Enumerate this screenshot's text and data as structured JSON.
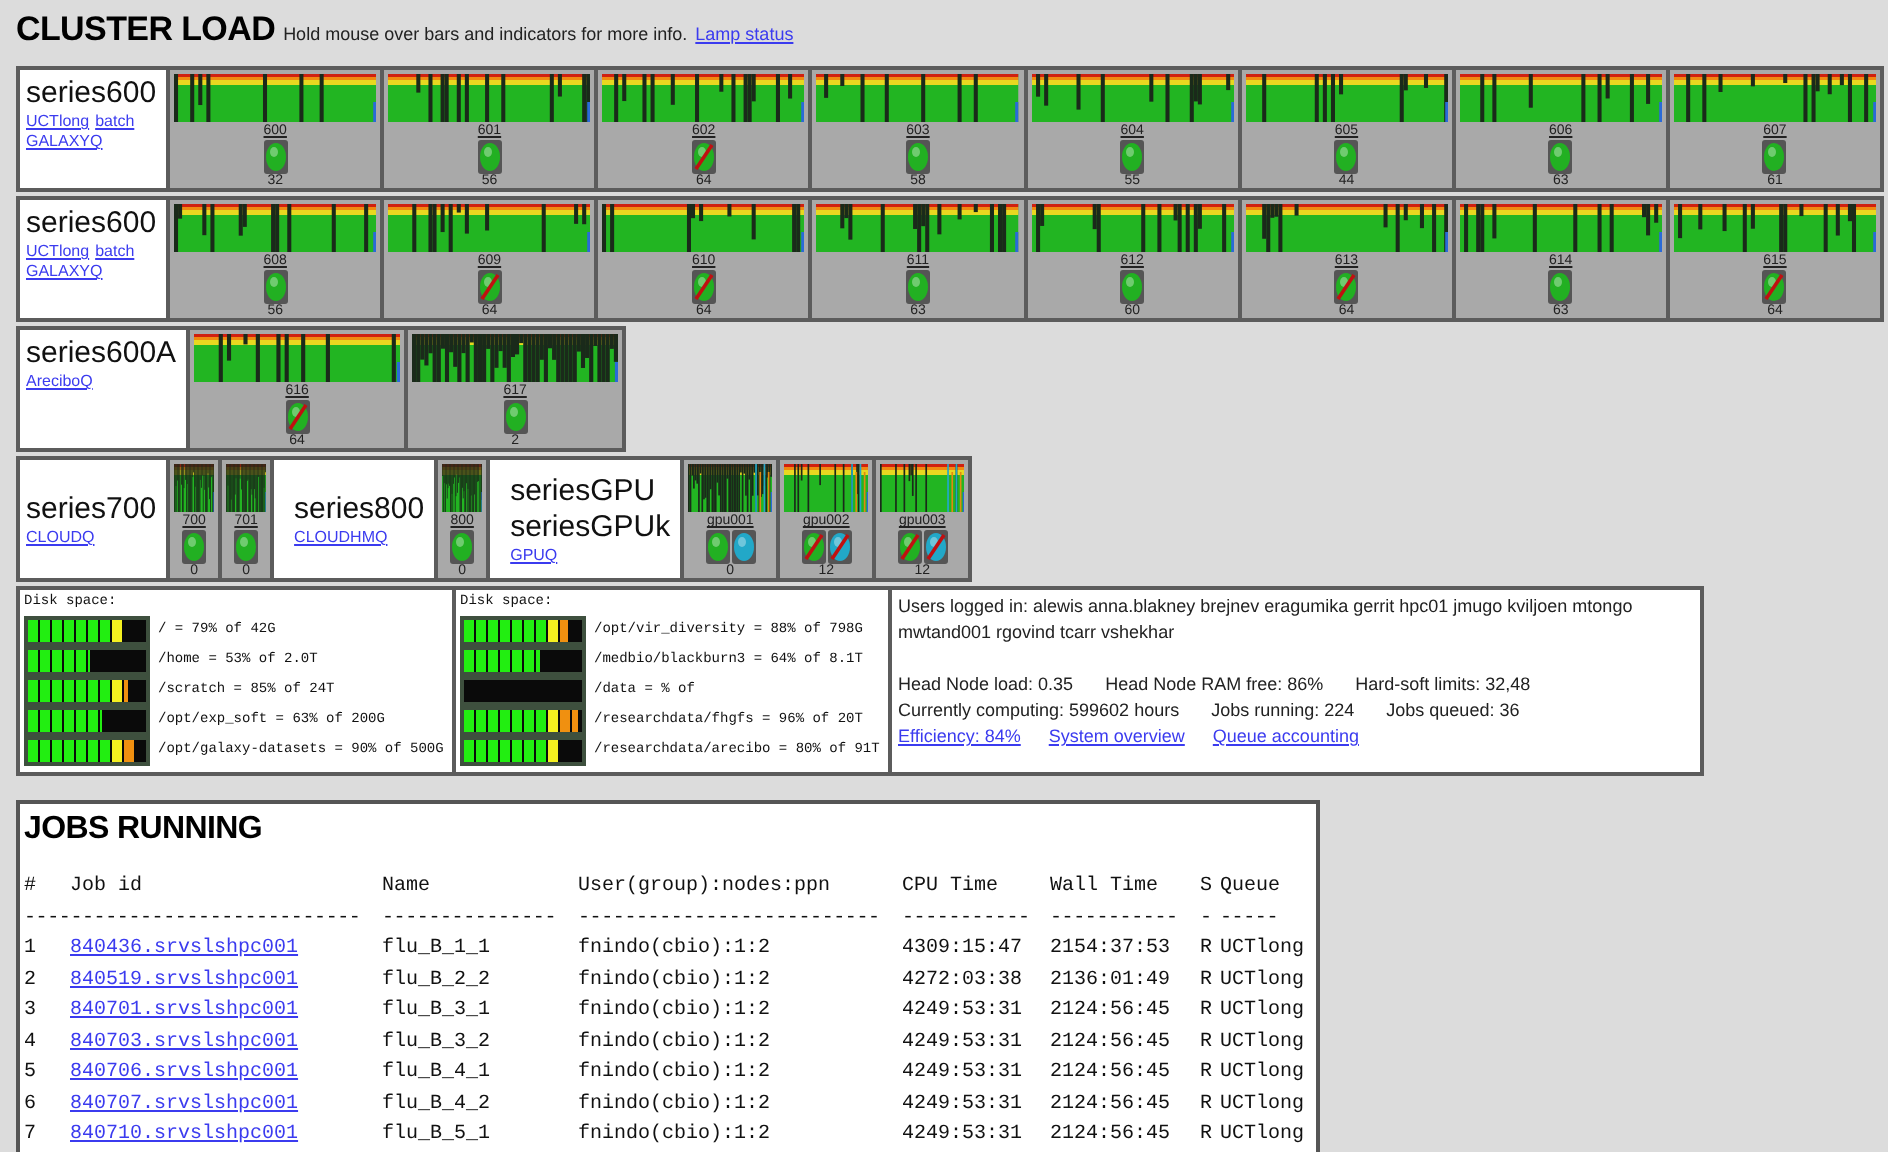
{
  "header": {
    "title": "CLUSTER LOAD",
    "hint": "Hold mouse over bars and indicators for more info.",
    "link": "Lamp status"
  },
  "rows": [
    {
      "kind": "full",
      "groups": [
        {
          "names": [
            "series600"
          ],
          "links": [
            "UCTlong",
            "batch",
            "GALAXYQ"
          ],
          "nodes": [
            {
              "name": "600",
              "count": "32",
              "idle": false,
              "lamps": [
                {
                  "color": "#22b022",
                  "crossed": false
                }
              ]
            },
            {
              "name": "601",
              "count": "56",
              "idle": false,
              "lamps": [
                {
                  "color": "#22b022",
                  "crossed": false
                }
              ]
            },
            {
              "name": "602",
              "count": "64",
              "idle": false,
              "lamps": [
                {
                  "color": "#22b022",
                  "crossed": true
                }
              ]
            },
            {
              "name": "603",
              "count": "58",
              "idle": false,
              "lamps": [
                {
                  "color": "#22b022",
                  "crossed": false
                }
              ]
            },
            {
              "name": "604",
              "count": "55",
              "idle": false,
              "lamps": [
                {
                  "color": "#22b022",
                  "crossed": false
                }
              ]
            },
            {
              "name": "605",
              "count": "44",
              "idle": false,
              "lamps": [
                {
                  "color": "#22b022",
                  "crossed": false
                }
              ]
            },
            {
              "name": "606",
              "count": "63",
              "idle": false,
              "lamps": [
                {
                  "color": "#22b022",
                  "crossed": false
                }
              ]
            },
            {
              "name": "607",
              "count": "61",
              "idle": false,
              "lamps": [
                {
                  "color": "#22b022",
                  "crossed": false
                }
              ]
            }
          ]
        }
      ]
    },
    {
      "kind": "full",
      "groups": [
        {
          "names": [
            "series600"
          ],
          "links": [
            "UCTlong",
            "batch",
            "GALAXYQ"
          ],
          "nodes": [
            {
              "name": "608",
              "count": "56",
              "idle": false,
              "lamps": [
                {
                  "color": "#22b022",
                  "crossed": false
                }
              ]
            },
            {
              "name": "609",
              "count": "64",
              "idle": false,
              "lamps": [
                {
                  "color": "#22b022",
                  "crossed": true
                }
              ]
            },
            {
              "name": "610",
              "count": "64",
              "idle": false,
              "lamps": [
                {
                  "color": "#22b022",
                  "crossed": true
                }
              ]
            },
            {
              "name": "611",
              "count": "63",
              "idle": false,
              "lamps": [
                {
                  "color": "#22b022",
                  "crossed": false
                }
              ]
            },
            {
              "name": "612",
              "count": "60",
              "idle": false,
              "lamps": [
                {
                  "color": "#22b022",
                  "crossed": false
                }
              ]
            },
            {
              "name": "613",
              "count": "64",
              "idle": false,
              "lamps": [
                {
                  "color": "#22b022",
                  "crossed": true
                }
              ]
            },
            {
              "name": "614",
              "count": "63",
              "idle": false,
              "lamps": [
                {
                  "color": "#22b022",
                  "crossed": false
                }
              ]
            },
            {
              "name": "615",
              "count": "64",
              "idle": false,
              "lamps": [
                {
                  "color": "#22b022",
                  "crossed": true
                }
              ]
            }
          ]
        }
      ]
    },
    {
      "kind": "fixed",
      "groups": [
        {
          "names": [
            "series600A"
          ],
          "links": [
            "AreciboQ"
          ],
          "nodes": [
            {
              "name": "616",
              "count": "64",
              "idle": false,
              "lamps": [
                {
                  "color": "#22b022",
                  "crossed": true
                }
              ]
            },
            {
              "name": "617",
              "count": "2",
              "idle": true,
              "lamps": [
                {
                  "color": "#22b022",
                  "crossed": false
                }
              ]
            }
          ]
        }
      ]
    },
    {
      "kind": "compact",
      "groups": [
        {
          "names": [
            "series700"
          ],
          "links": [
            "CLOUDQ"
          ],
          "nodes": [
            {
              "name": "700",
              "count": "0",
              "idle": true,
              "lamps": [
                {
                  "color": "#22b022",
                  "crossed": false
                }
              ]
            },
            {
              "name": "701",
              "count": "0",
              "idle": true,
              "lamps": [
                {
                  "color": "#22b022",
                  "crossed": false
                }
              ]
            }
          ]
        },
        {
          "names": [
            "series800"
          ],
          "links": [
            "CLOUDHMQ"
          ],
          "nodes": [
            {
              "name": "800",
              "count": "0",
              "idle": true,
              "lamps": [
                {
                  "color": "#22b022",
                  "crossed": false
                }
              ]
            }
          ]
        },
        {
          "names": [
            "seriesGPU",
            "seriesGPUk"
          ],
          "links": [
            "GPUQ"
          ],
          "nodes": [
            {
              "name": "gpu001",
              "count": "0",
              "idle": true,
              "lamps": [
                {
                  "color": "#22b022",
                  "crossed": false
                },
                {
                  "color": "#22a8c8",
                  "crossed": false
                }
              ]
            },
            {
              "name": "gpu002",
              "count": "12",
              "idle": false,
              "lamps": [
                {
                  "color": "#22b022",
                  "crossed": true
                },
                {
                  "color": "#22a8c8",
                  "crossed": true
                }
              ]
            },
            {
              "name": "gpu003",
              "count": "12",
              "idle": false,
              "lamps": [
                {
                  "color": "#22b022",
                  "crossed": true
                },
                {
                  "color": "#22a8c8",
                  "crossed": true
                }
              ]
            }
          ]
        }
      ]
    }
  ],
  "disks": [
    {
      "title": "Disk space:",
      "mounts": [
        {
          "text": "/ = 79% of 42G",
          "level": 0.79
        },
        {
          "text": "/home = 53% of 2.0T",
          "level": 0.53
        },
        {
          "text": "/scratch = 85% of 24T",
          "level": 0.85
        },
        {
          "text": "/opt/exp_soft = 63% of 200G",
          "level": 0.63
        },
        {
          "text": "/opt/galaxy-datasets = 90% of 500G",
          "level": 0.9
        }
      ]
    },
    {
      "title": "Disk space:",
      "mounts": [
        {
          "text": "/opt/vir_diversity = 88% of 798G",
          "level": 0.88
        },
        {
          "text": "/medbio/blackburn3 = 64% of 8.1T",
          "level": 0.64
        },
        {
          "text": "/data = % of",
          "level": 0
        },
        {
          "text": "/researchdata/fhgfs = 96% of 20T",
          "level": 0.96
        },
        {
          "text": "/researchdata/arecibo = 80% of 91T",
          "level": 0.8
        }
      ]
    }
  ],
  "info": {
    "users": "Users logged in: alewis anna.blakney brejnev eragumika gerrit hpc01 jmugo kviljoen mtongo mwtand001 rgovind tcarr vshekhar",
    "stat_lines": [
      [
        "Head Node load: 0.35",
        "Head Node RAM free: 86%",
        "Hard-soft limits: 32,48"
      ],
      [
        "Currently computing: 599602 hours",
        "Jobs running: 224",
        "Jobs queued: 36"
      ]
    ],
    "links": [
      "Efficiency: 84%",
      "System overview",
      "Queue accounting"
    ]
  },
  "jobs": {
    "title": "JOBS RUNNING",
    "columns": [
      "#",
      "Job id",
      "Name",
      "User(group):nodes:ppn",
      "CPU Time",
      "Wall Time",
      "S",
      "Queue"
    ],
    "separators": [
      "-----------------------------",
      "---------------",
      "--------------------------",
      "-----------",
      "-----------",
      "-",
      "-----"
    ],
    "rows": [
      [
        "1",
        "840436.srvslshpc001",
        "flu_B_1_1",
        "fnindo(cbio):1:2",
        "4309:15:47",
        "2154:37:53",
        "R",
        "UCTlong"
      ],
      [
        "2",
        "840519.srvslshpc001",
        "flu_B_2_2",
        "fnindo(cbio):1:2",
        "4272:03:38",
        "2136:01:49",
        "R",
        "UCTlong"
      ],
      [
        "3",
        "840701.srvslshpc001",
        "flu_B_3_1",
        "fnindo(cbio):1:2",
        "4249:53:31",
        "2124:56:45",
        "R",
        "UCTlong"
      ],
      [
        "4",
        "840703.srvslshpc001",
        "flu_B_3_2",
        "fnindo(cbio):1:2",
        "4249:53:31",
        "2124:56:45",
        "R",
        "UCTlong"
      ],
      [
        "5",
        "840706.srvslshpc001",
        "flu_B_4_1",
        "fnindo(cbio):1:2",
        "4249:53:31",
        "2124:56:45",
        "R",
        "UCTlong"
      ],
      [
        "6",
        "840707.srvslshpc001",
        "flu_B_4_2",
        "fnindo(cbio):1:2",
        "4249:53:31",
        "2124:56:45",
        "R",
        "UCTlong"
      ],
      [
        "7",
        "840710.srvslshpc001",
        "flu_B_5_1",
        "fnindo(cbio):1:2",
        "4249:53:31",
        "2124:56:45",
        "R",
        "UCTlong"
      ]
    ]
  }
}
